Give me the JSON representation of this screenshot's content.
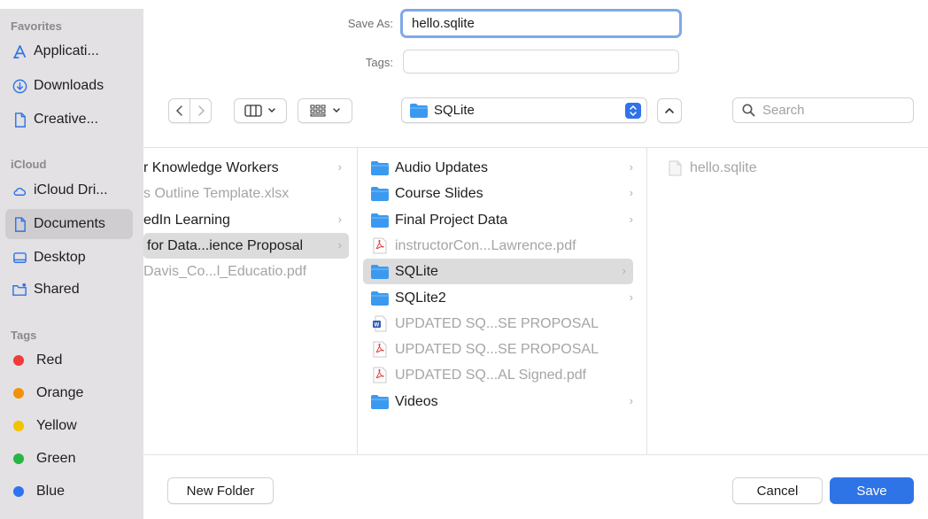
{
  "save_as": {
    "label": "Save As:",
    "value": "hello.sqlite"
  },
  "tags": {
    "label": "Tags:",
    "value": ""
  },
  "location": {
    "name": "SQLite"
  },
  "search": {
    "placeholder": "Search"
  },
  "sidebar": {
    "favorites_header": "Favorites",
    "favorites": [
      {
        "label": "Applicati...",
        "icon": "applications-icon"
      },
      {
        "label": "Downloads",
        "icon": "downloads-icon"
      },
      {
        "label": "Creative...",
        "icon": "document-icon"
      }
    ],
    "icloud_header": "iCloud",
    "icloud": [
      {
        "label": "iCloud Dri...",
        "icon": "cloud-icon"
      },
      {
        "label": "Documents",
        "icon": "document-icon",
        "selected": true
      },
      {
        "label": "Desktop",
        "icon": "desktop-icon"
      },
      {
        "label": "Shared",
        "icon": "shared-folder-icon"
      }
    ],
    "tags_header": "Tags",
    "tags": [
      {
        "label": "Red",
        "color": "#f23a3a"
      },
      {
        "label": "Orange",
        "color": "#f2920c"
      },
      {
        "label": "Yellow",
        "color": "#f2c300"
      },
      {
        "label": "Green",
        "color": "#27b544"
      },
      {
        "label": "Blue",
        "color": "#2e74f0"
      }
    ]
  },
  "columns": {
    "col1": [
      {
        "label": "r Knowledge Workers",
        "chevron": true
      },
      {
        "label": "s Outline Template.xlsx",
        "dim": true
      },
      {
        "label": "edIn Learning",
        "chevron": true
      },
      {
        "label": "for Data...ience Proposal",
        "chevron": true,
        "selected": true
      },
      {
        "label": "Davis_Co...l_Educatio.pdf",
        "dim": true
      }
    ],
    "col2": [
      {
        "label": "Audio Updates",
        "icon": "folder-icon",
        "chevron": true
      },
      {
        "label": "Course Slides",
        "icon": "folder-icon",
        "chevron": true
      },
      {
        "label": "Final Project Data",
        "icon": "folder-icon",
        "chevron": true
      },
      {
        "label": "instructorCon...Lawrence.pdf",
        "icon": "pdf-icon",
        "dim": true
      },
      {
        "label": "SQLite",
        "icon": "folder-icon",
        "chevron": true,
        "selected": true
      },
      {
        "label": "SQLite2",
        "icon": "folder-icon",
        "chevron": true
      },
      {
        "label": "UPDATED SQ...SE PROPOSAL",
        "icon": "word-doc-icon",
        "dim": true
      },
      {
        "label": "UPDATED SQ...SE PROPOSAL",
        "icon": "pdf-icon",
        "dim": true
      },
      {
        "label": "UPDATED SQ...AL Signed.pdf",
        "icon": "pdf-icon",
        "dim": true
      },
      {
        "label": "Videos",
        "icon": "folder-icon",
        "chevron": true
      }
    ],
    "col3": [
      {
        "label": "hello.sqlite",
        "icon": "generic-file-icon",
        "dim": true
      }
    ]
  },
  "buttons": {
    "new_folder": "New Folder",
    "cancel": "Cancel",
    "save": "Save"
  },
  "colors": {
    "accent": "#2f74e6",
    "folder": "#3b9af0",
    "sidebar_bg": "#e3e1e3"
  }
}
